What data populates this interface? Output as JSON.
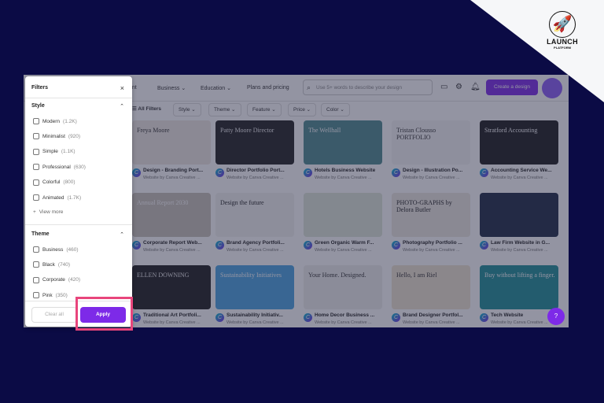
{
  "brand": {
    "logo_text": "LAUNCH",
    "logo_sub": "PLATFORM"
  },
  "header": {
    "nav": [
      "...nt",
      "Business",
      "Education",
      "Plans and pricing"
    ],
    "search_placeholder": "Use 5+ words to describe your design",
    "create_label": "Create a design"
  },
  "chips": [
    "All Filters",
    "Style",
    "Theme",
    "Feature",
    "Price",
    "Color"
  ],
  "cards": [
    {
      "title": "Design - Branding Port...",
      "sub": "Website by Canva Creative ...",
      "thumb": "Freya Moore",
      "bg": "#efe9e2",
      "fg": "#333"
    },
    {
      "title": "Director Portfolio Port...",
      "sub": "Website by Canva Creative ...",
      "thumb": "Patty Moore Director",
      "bg": "#222",
      "fg": "#eee"
    },
    {
      "title": "Hotels Business Website",
      "sub": "Website by Canva Creative ...",
      "thumb": "The Wellhall",
      "bg": "#4f8a8f",
      "fg": "#fff"
    },
    {
      "title": "Design - Illustration Po...",
      "sub": "Website by Canva Creative ...",
      "thumb": "Tristan Clousso PORTFOLIO",
      "bg": "#f5f5f5",
      "fg": "#333"
    },
    {
      "title": "Accounting Service We...",
      "sub": "Website by Canva Creative ...",
      "thumb": "Stratford Accounting",
      "bg": "#1c1c1c",
      "fg": "#fff"
    },
    {
      "title": "Corporate Report Web...",
      "sub": "Website by Canva Creative ...",
      "thumb": "Annual Report 2030",
      "bg": "#c9c2b8",
      "fg": "#fff"
    },
    {
      "title": "Brand Agency Portfoli...",
      "sub": "Website by Canva Creative ...",
      "thumb": "Design the future",
      "bg": "#f2f2f0",
      "fg": "#222"
    },
    {
      "title": "Green Organic Warm F...",
      "sub": "Website by Canva Creative ...",
      "thumb": "",
      "bg": "#dfe6d8",
      "fg": "#333"
    },
    {
      "title": "Photography Portfolio ...",
      "sub": "Website by Canva Creative ...",
      "thumb": "PHOTO-GRAPHS by Delora Butler",
      "bg": "#ece8e0",
      "fg": "#222"
    },
    {
      "title": "Law Firm Website in G...",
      "sub": "Website by Canva Creative ...",
      "thumb": "",
      "bg": "#1f2a44",
      "fg": "#fff"
    },
    {
      "title": "Traditional Art Portfoli...",
      "sub": "Website by Canva Creative ...",
      "thumb": "ELLEN DOWNING",
      "bg": "#1e1e1e",
      "fg": "#eee"
    },
    {
      "title": "Sustainability Initiativ...",
      "sub": "Website by Canva Creative ...",
      "thumb": "Sustainability Initiatives",
      "bg": "#4aa3e0",
      "fg": "#fff"
    },
    {
      "title": "Home Decor Business ...",
      "sub": "Website by Canva Creative ...",
      "thumb": "Your Home. Designed.",
      "bg": "#eeeeec",
      "fg": "#333"
    },
    {
      "title": "Brand Designer Portfol...",
      "sub": "Website by Canva Creative ...",
      "thumb": "Hello, I am Riel",
      "bg": "#efe4d0",
      "fg": "#333"
    },
    {
      "title": "Tech Website",
      "sub": "Website by Canva Creative ...",
      "thumb": "Buy without lifting a finger.",
      "bg": "#1f8f96",
      "fg": "#fff"
    }
  ],
  "filters": {
    "title": "Filters",
    "style_heading": "Style",
    "style": [
      {
        "label": "Modern",
        "count": "(1.2K)"
      },
      {
        "label": "Minimalist",
        "count": "(920)"
      },
      {
        "label": "Simple",
        "count": "(1.1K)"
      },
      {
        "label": "Professional",
        "count": "(630)"
      },
      {
        "label": "Colorful",
        "count": "(800)"
      },
      {
        "label": "Animated",
        "count": "(1.7K)"
      }
    ],
    "view_more": "View more",
    "theme_heading": "Theme",
    "theme": [
      {
        "label": "Business",
        "count": "(460)"
      },
      {
        "label": "Black",
        "count": "(740)"
      },
      {
        "label": "Corporate",
        "count": "(420)"
      },
      {
        "label": "Pink",
        "count": "(350)"
      }
    ],
    "clear_label": "Clear all",
    "apply_label": "Apply"
  },
  "help_label": "?",
  "colors": {
    "accent": "#7d2ae8",
    "highlight": "#e8457c",
    "background": "#0b0b45"
  }
}
